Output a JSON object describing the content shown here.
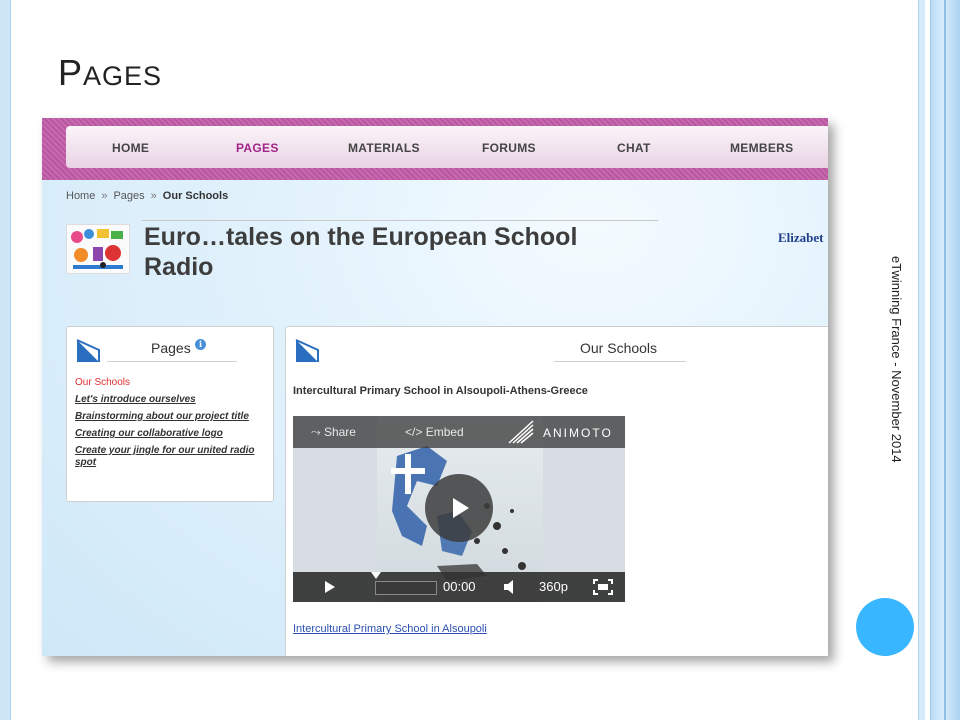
{
  "slide": {
    "title_first": "P",
    "title_rest": "ages",
    "side_text": "eTwinning France - November 2014"
  },
  "nav": {
    "items": [
      "HOME",
      "PAGES",
      "MATERIALS",
      "FORUMS",
      "CHAT",
      "MEMBERS"
    ],
    "active": "PAGES"
  },
  "breadcrumb": {
    "home": "Home",
    "pages": "Pages",
    "current": "Our Schools",
    "separator": "»"
  },
  "project": {
    "title_line1": "Euro…tales on the European School",
    "title_line2": "Radio",
    "user_name": "Elizabet"
  },
  "sidebar": {
    "heading": "Pages",
    "info_icon": "i",
    "items": [
      "Our Schools",
      "Let's introduce ourselves",
      "Brainstorming about our project title",
      "Creating our collaborative logo",
      "Create your jingle for our united radio spot"
    ]
  },
  "main": {
    "heading": "Our Schools",
    "school_name": "Intercultural Primary School in Alsoupoli-Athens-Greece",
    "video": {
      "share_label": "Share",
      "embed_label": "Embed",
      "brand": "ANIMOTO",
      "time": "00:00",
      "quality": "360p",
      "progress": 0
    },
    "bottom_link": "Intercultural Primary School in Alsoupoli"
  },
  "colors": {
    "nav_purple": "#b8579f",
    "active_nav": "#a1268a",
    "current_page_red": "#e03030",
    "link_blue": "#2a4fb0",
    "accent_circle": "#38b6ff"
  }
}
